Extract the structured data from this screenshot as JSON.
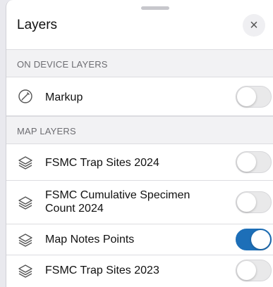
{
  "panel": {
    "title": "Layers",
    "close_glyph": "×"
  },
  "sections": [
    {
      "header": "ON DEVICE LAYERS",
      "items": [
        {
          "label": "Markup",
          "icon": "markup-icon",
          "enabled": false
        }
      ]
    },
    {
      "header": "MAP LAYERS",
      "items": [
        {
          "label": "FSMC Trap Sites 2024",
          "icon": "layers-icon",
          "enabled": false
        },
        {
          "label": "FSMC Cumulative Specimen Count 2024",
          "icon": "layers-icon",
          "enabled": false
        },
        {
          "label": "Map Notes Points",
          "icon": "layers-icon",
          "enabled": true
        },
        {
          "label": "FSMC Trap Sites 2023",
          "icon": "layers-icon",
          "enabled": false
        }
      ]
    }
  ],
  "colors": {
    "toggle_on": "#1d6fb8",
    "toggle_off": "#e9e9ea"
  }
}
